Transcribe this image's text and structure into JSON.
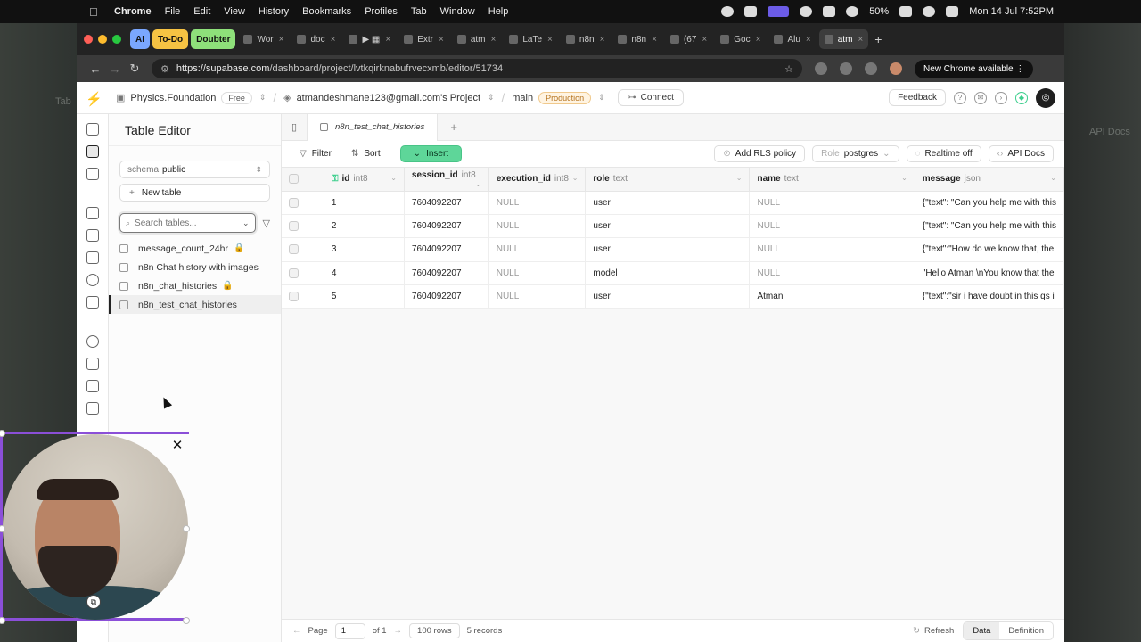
{
  "menubar": {
    "app": "Chrome",
    "items": [
      "File",
      "Edit",
      "View",
      "History",
      "Bookmarks",
      "Profiles",
      "Tab",
      "Window",
      "Help"
    ],
    "battery": "50%",
    "datetime": "Mon 14 Jul  7:52PM"
  },
  "tabs": [
    {
      "label": "AI",
      "group": true,
      "color": "#7aa7ff"
    },
    {
      "label": "To-Do",
      "group": true,
      "color": "#f6c343"
    },
    {
      "label": "Doubter",
      "group": true,
      "color": "#8ee07a"
    },
    {
      "label": "Wor"
    },
    {
      "label": "doc"
    },
    {
      "label": "▶ ▦"
    },
    {
      "label": "Extr"
    },
    {
      "label": "atm"
    },
    {
      "label": "LaTe"
    },
    {
      "label": "n8n"
    },
    {
      "label": "n8n"
    },
    {
      "label": "(67"
    },
    {
      "label": "Goc"
    },
    {
      "label": "Alu"
    },
    {
      "label": "atm",
      "active": true
    }
  ],
  "address": {
    "host": "https://supabase.com",
    "path": "/dashboard/project/lvtkqirknabufrvecxmb/editor/51734",
    "update_label": "New Chrome available"
  },
  "topbar": {
    "org": "Physics.Foundation",
    "org_plan": "Free",
    "project": "atmandeshmane123@gmail.com's Project",
    "branch": "main",
    "env": "Production",
    "connect": "Connect",
    "feedback": "Feedback"
  },
  "panel": {
    "title": "Table Editor",
    "schema_label": "schema",
    "schema_value": "public",
    "new_table": "New table",
    "search_placeholder": "Search tables...",
    "tables": [
      {
        "name": "message_count_24hr",
        "locked": true
      },
      {
        "name": "n8n Chat history with images",
        "locked": false
      },
      {
        "name": "n8n_chat_histories",
        "locked": true
      },
      {
        "name": "n8n_test_chat_histories",
        "locked": false,
        "active": true
      }
    ]
  },
  "editor": {
    "active_tab": "n8n_test_chat_histories",
    "toolbar": {
      "filter": "Filter",
      "sort": "Sort",
      "insert": "Insert",
      "rls": "Add RLS policy",
      "role_label": "Role",
      "role_value": "postgres",
      "realtime": "Realtime off",
      "api_docs": "API Docs"
    },
    "columns": [
      {
        "name": "id",
        "type": "int8",
        "key": true
      },
      {
        "name": "session_id",
        "type": "int8"
      },
      {
        "name": "execution_id",
        "type": "int8"
      },
      {
        "name": "role",
        "type": "text"
      },
      {
        "name": "name",
        "type": "text"
      },
      {
        "name": "message",
        "type": "json"
      }
    ],
    "rows": [
      [
        "1",
        "7604092207",
        "NULL",
        "user",
        "NULL",
        "{\"text\": \"Can you help me with this"
      ],
      [
        "2",
        "7604092207",
        "NULL",
        "user",
        "NULL",
        "{\"text\": \"Can you help me with this"
      ],
      [
        "3",
        "7604092207",
        "NULL",
        "user",
        "NULL",
        "{\"text\":\"How do we know that, the"
      ],
      [
        "4",
        "7604092207",
        "NULL",
        "model",
        "NULL",
        "\"Hello Atman \\nYou know that the"
      ],
      [
        "5",
        "7604092207",
        "NULL",
        "user",
        "Atman",
        "{\"text\":\"sir i have doubt in this qs i"
      ]
    ],
    "footer": {
      "page_label": "Page",
      "page_value": "1",
      "of_label": "of 1",
      "rows_label": "100 rows",
      "records": "5 records",
      "refresh": "Refresh",
      "data": "Data",
      "definition": "Definition"
    }
  },
  "colors": {
    "brand": "#3ecf8e",
    "webcam_border": "#8b4fd8"
  }
}
